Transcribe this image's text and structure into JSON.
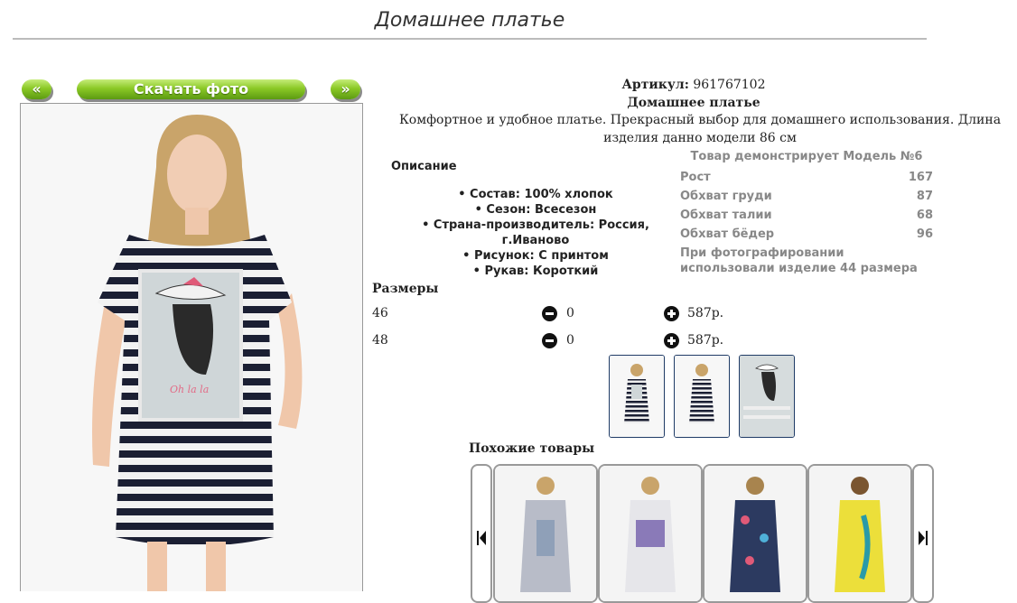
{
  "page_title": "Домашнее платье",
  "nav": {
    "prev_label": "«",
    "download_label": "Скачать фото",
    "next_label": "»"
  },
  "product": {
    "article_label": "Артикул:",
    "article_value": "961767102",
    "name": "Домашнее платье",
    "description": "Комфортное и удобное платье. Прекрасный выбор для домашнего использования. Длина изделия данно модели 86 см",
    "desc_heading": "Описание",
    "specs": [
      "• Состав: 100% хлопок",
      "• Сезон: Всесезон",
      "• Страна-производитель: Россия, г.Иваново",
      "• Рисунок: С принтом",
      "• Рукав: Короткий"
    ]
  },
  "model": {
    "heading": "Товар демонстрирует Модель №6",
    "rows": [
      {
        "label": "Рост",
        "value": "167"
      },
      {
        "label": "Обхват груди",
        "value": "87"
      },
      {
        "label": "Обхват талии",
        "value": "68"
      },
      {
        "label": "Обхват бёдер",
        "value": "96"
      }
    ],
    "note": "При фотографировании использовали изделие 44 размера"
  },
  "sizes": {
    "heading": "Размеры",
    "rows": [
      {
        "size": "46",
        "qty": "0",
        "price": "587р."
      },
      {
        "size": "48",
        "qty": "0",
        "price": "587р."
      }
    ]
  },
  "similar": {
    "heading": "Похожие товары"
  },
  "colors": {
    "accent_green": "#7cbd1f",
    "thumb_border": "#1f3b66",
    "model_text": "#888888"
  }
}
